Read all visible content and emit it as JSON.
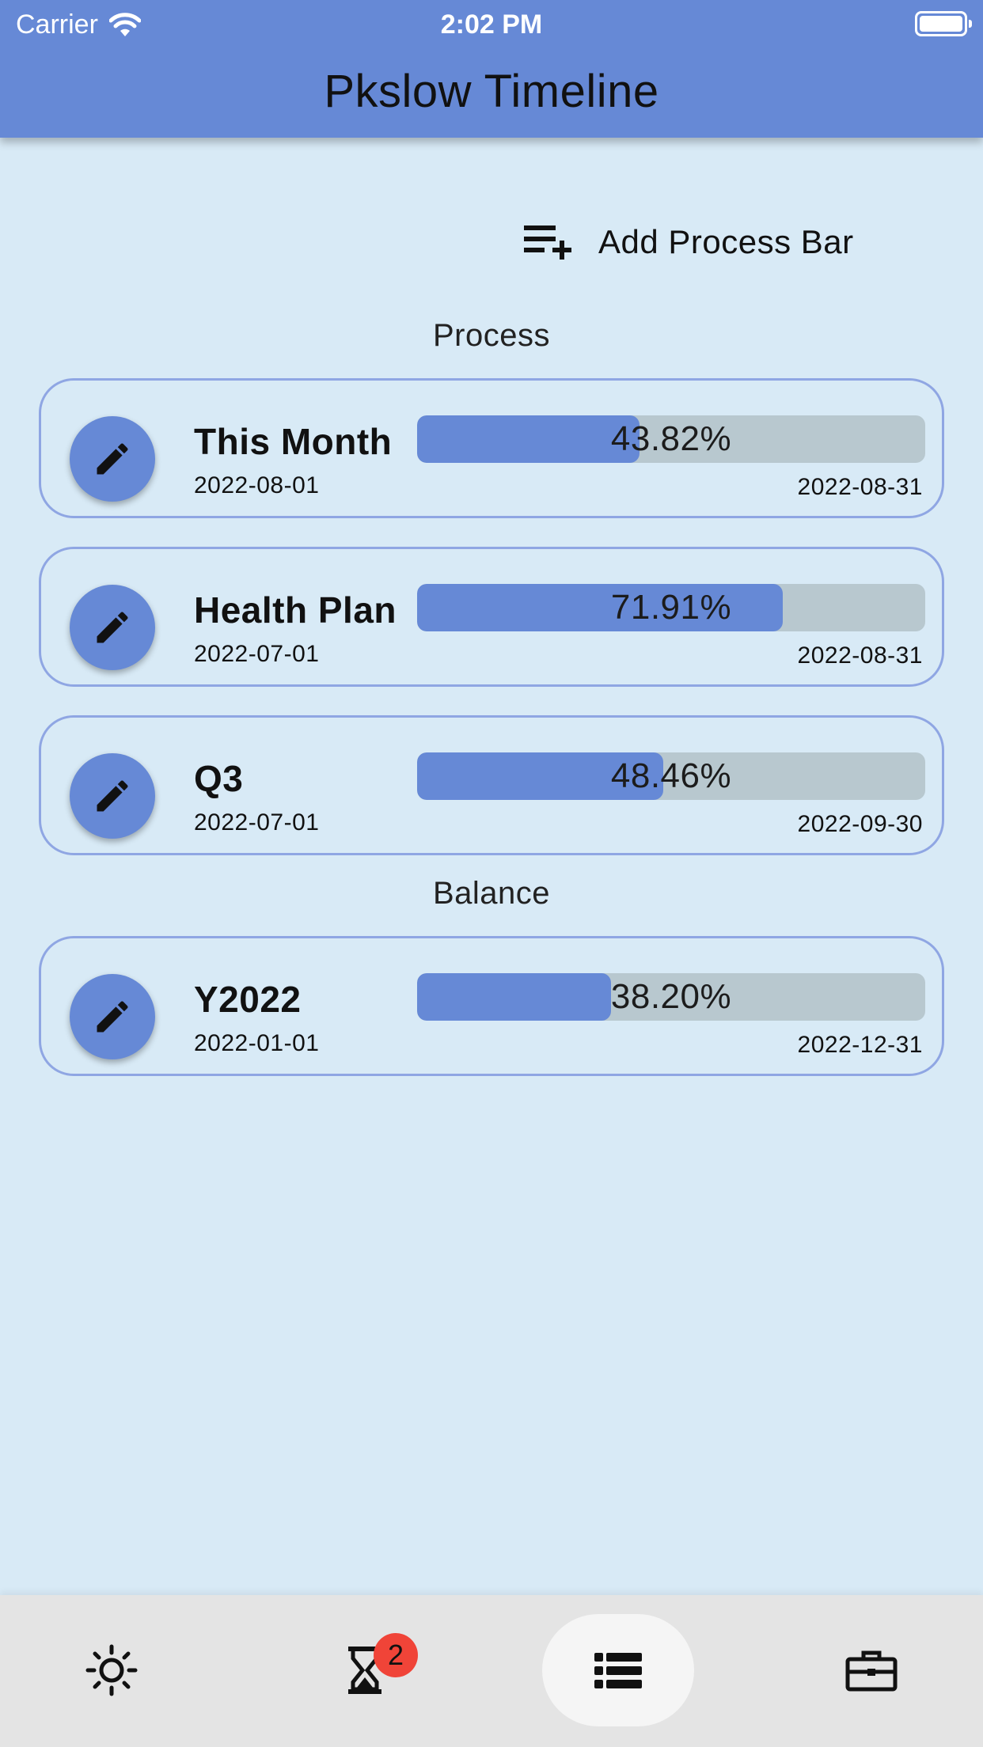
{
  "status_bar": {
    "carrier": "Carrier",
    "time": "2:02 PM"
  },
  "app_bar": {
    "title": "Pkslow Timeline"
  },
  "add_button": {
    "label": "Add Process Bar",
    "icon": "playlist-add-icon"
  },
  "sections": [
    {
      "title": "Process",
      "items": [
        {
          "name": "This Month",
          "start": "2022-08-01",
          "end": "2022-08-31",
          "percent_label": "43.82%",
          "progress": 0.4382
        },
        {
          "name": "Health Plan",
          "start": "2022-07-01",
          "end": "2022-08-31",
          "percent_label": "71.91%",
          "progress": 0.7191
        },
        {
          "name": "Q3",
          "start": "2022-07-01",
          "end": "2022-09-30",
          "percent_label": "48.46%",
          "progress": 0.4846
        }
      ]
    },
    {
      "title": "Balance",
      "items": [
        {
          "name": "Y2022",
          "start": "2022-01-01",
          "end": "2022-12-31",
          "percent_label": "38.20%",
          "progress": 0.382
        }
      ]
    }
  ],
  "bottom_nav": {
    "items": [
      {
        "icon": "sun-icon",
        "active": false
      },
      {
        "icon": "hourglass-icon",
        "active": false,
        "badge": "2"
      },
      {
        "icon": "list-icon",
        "active": true
      },
      {
        "icon": "briefcase-icon",
        "active": false
      }
    ]
  },
  "colors": {
    "primary": "#6689d6",
    "background": "#d8eaf6",
    "track": "#b8c8cf",
    "card_border": "#8fa6e3",
    "badge": "#f04438"
  }
}
